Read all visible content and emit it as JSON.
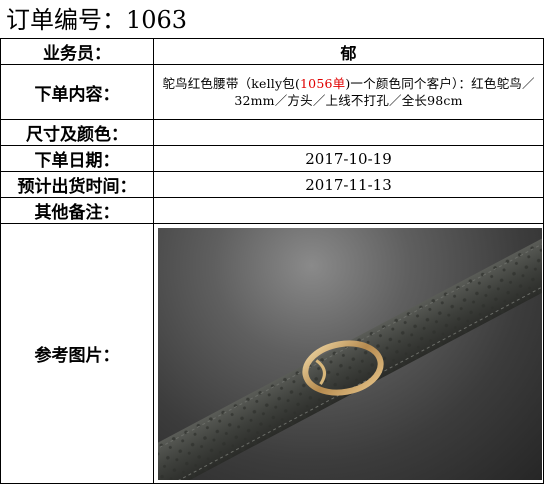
{
  "header": {
    "title": "订单编号：1063"
  },
  "rows": {
    "salesperson": {
      "label": "业务员：",
      "value": "郁"
    },
    "content": {
      "label": "下单内容：",
      "text_before": "鸵鸟红色腰带（kelly包(",
      "highlight": "1056单",
      "text_after": ")一个颜色同个客户）：红色鸵鸟／32mm／方头／上线不打孔／全长98cm"
    },
    "size_color": {
      "label": "尺寸及颜色：",
      "value": ""
    },
    "order_date": {
      "label": "下单日期：",
      "value": "2017-10-19"
    },
    "ship_date": {
      "label": "预计出货时间：",
      "value": "2017-11-13"
    },
    "notes": {
      "label": "其他备注：",
      "value": ""
    },
    "photo": {
      "label": "参考图片："
    }
  },
  "colors": {
    "highlight": "#e00000",
    "border": "#000000"
  }
}
